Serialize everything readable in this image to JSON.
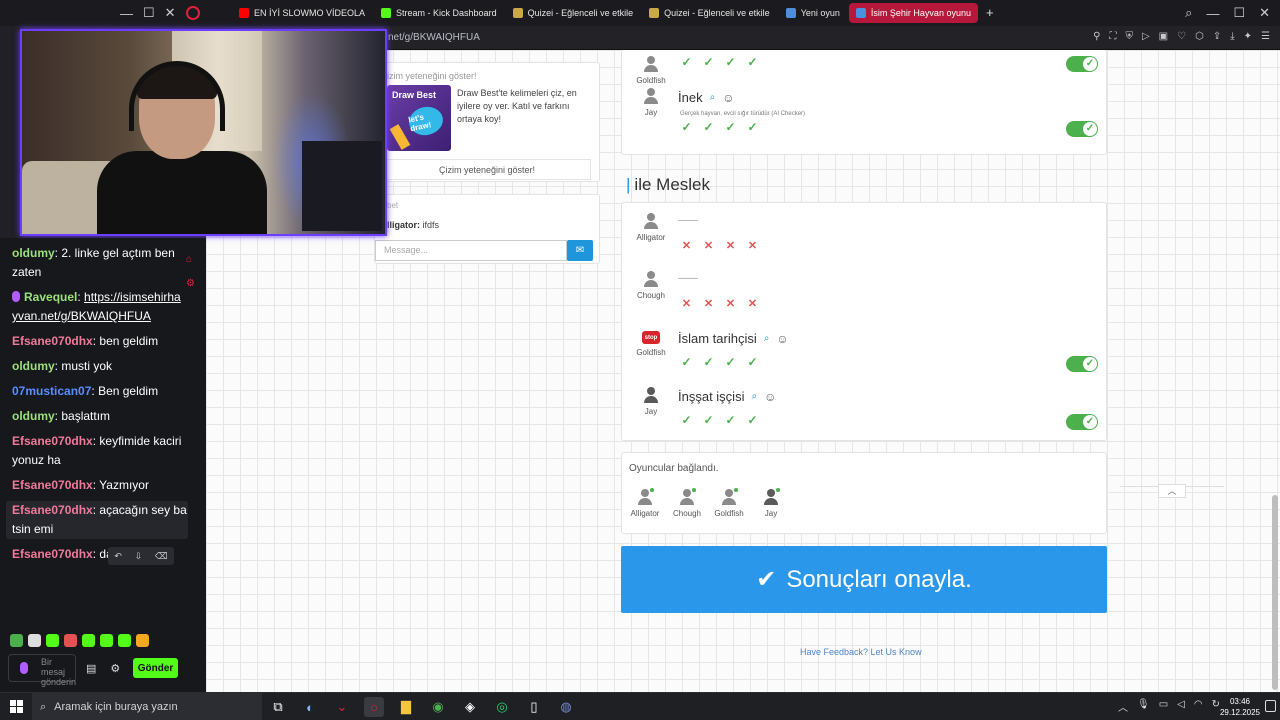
{
  "browser": {
    "tabs": [
      {
        "label": "EN İYİ SLOWMO VİDEOLA",
        "color": "#ff0000"
      },
      {
        "label": "Stream - Kick Dashboard",
        "color": "#53fc18"
      },
      {
        "label": "Quizei - Eğlenceli ve etkile",
        "color": "#c8a84a"
      },
      {
        "label": "Quizei - Eğlenceli ve etkile",
        "color": "#c8a84a"
      },
      {
        "label": "Yeni oyun",
        "color": "#4a8fe0"
      },
      {
        "label": "İsim Şehir Hayvan oyunu",
        "color": "#4a8fe0"
      }
    ],
    "url": "net/g/BKWAIQHFUA"
  },
  "draw": {
    "title": "izim yeteneğini göster!",
    "image_title": "Draw Best",
    "image_badge": "let's draw!",
    "description": "Draw Best'te kelimeleri çiz, en iyilere oy ver. Katıl ve farkını ortaya koy!",
    "button": "Çizim yeteneğini göster!"
  },
  "game_chat": {
    "title": "bet",
    "line_user": "lligator:",
    "line_text": "ifdfs",
    "placeholder": "Message..."
  },
  "results_top": {
    "rows": [
      {
        "player": "Goldfish",
        "answer": "",
        "marks": [
          "ok",
          "ok",
          "ok",
          "ok"
        ],
        "toggle": true
      },
      {
        "player": "Jay",
        "answer": "İnek",
        "note": "Gerçek hayvan, evcil sığır türüdür (AI Checker)",
        "marks": [
          "ok",
          "ok",
          "ok",
          "ok"
        ],
        "toggle": true
      }
    ]
  },
  "meslek": {
    "title": "ile Meslek",
    "rows": [
      {
        "player": "Alligator",
        "answer": "——",
        "marks": [
          "no",
          "no",
          "no",
          "no"
        ],
        "toggle": false,
        "avatar": "default"
      },
      {
        "player": "Chough",
        "answer": "——",
        "marks": [
          "no",
          "no",
          "no",
          "no"
        ],
        "toggle": false,
        "avatar": "default"
      },
      {
        "player": "Goldfish",
        "answer": "İslam tarihçisi",
        "marks": [
          "ok",
          "ok",
          "ok",
          "ok"
        ],
        "toggle": true,
        "avatar": "stop"
      },
      {
        "player": "Jay",
        "answer": "İnşşat işçisi",
        "marks": [
          "ok",
          "ok",
          "ok",
          "ok"
        ],
        "toggle": true,
        "avatar": "dark"
      }
    ]
  },
  "players": {
    "title": "Oyuncular bağlandı.",
    "list": [
      "Alligator",
      "Chough",
      "Goldfish",
      "Jay"
    ]
  },
  "confirm_button": "Sonuçları onayla.",
  "feedback_link": "Have Feedback? Let Us Know",
  "kick_chat": {
    "messages": [
      {
        "user": "oldumy",
        "color": "#9be07b",
        "text": "2. linke gel açtım ben zaten"
      },
      {
        "user": "Ravequel",
        "color": "#9be07b",
        "text": "https://isimsehirhayvan.net/g/BKWAIQHFUA",
        "link": true,
        "mic": true
      },
      {
        "user": "Efsane070dhx",
        "color": "#f07a9a",
        "text": "ben geldim"
      },
      {
        "user": "oldumy",
        "color": "#9be07b",
        "text": "musti yok"
      },
      {
        "user": "07mustican07",
        "color": "#5b8cff",
        "text": "Ben geldim"
      },
      {
        "user": "oldumy",
        "color": "#9be07b",
        "text": "başlattım"
      },
      {
        "user": "Efsane070dhx",
        "color": "#f07a9a",
        "text": "keyfimide kaciriyonuz ha"
      },
      {
        "user": "Efsane070dhx",
        "color": "#f07a9a",
        "text": "Yazmıyor"
      },
      {
        "user": "Efsane070dhx",
        "color": "#f07a9a",
        "text": "açacağın sey batsin emi",
        "highlight": true
      },
      {
        "user": "Efsane070dhx",
        "color": "#f07a9a",
        "text": "dasdada"
      }
    ],
    "compose_placeholder": "Bir mesaj gönderin",
    "send_label": "Gönder"
  },
  "taskbar": {
    "search_placeholder": "Aramak için buraya yazın",
    "time": "03:46",
    "date": "29.12.2025"
  }
}
